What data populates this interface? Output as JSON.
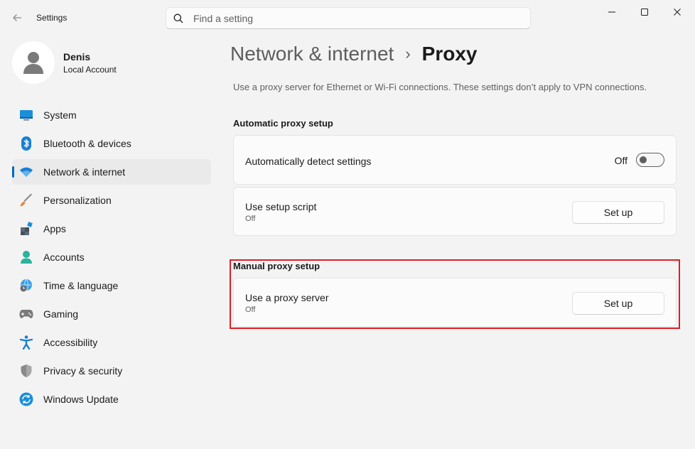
{
  "window": {
    "app_title": "Settings",
    "search_placeholder": "Find a setting"
  },
  "profile": {
    "name": "Denis",
    "account_type": "Local Account"
  },
  "sidebar": {
    "items": [
      {
        "label": "System",
        "icon": "system-icon"
      },
      {
        "label": "Bluetooth & devices",
        "icon": "bluetooth-icon"
      },
      {
        "label": "Network & internet",
        "icon": "wifi-icon",
        "active": true
      },
      {
        "label": "Personalization",
        "icon": "brush-icon"
      },
      {
        "label": "Apps",
        "icon": "apps-icon"
      },
      {
        "label": "Accounts",
        "icon": "accounts-icon"
      },
      {
        "label": "Time & language",
        "icon": "globe-clock-icon"
      },
      {
        "label": "Gaming",
        "icon": "gamepad-icon"
      },
      {
        "label": "Accessibility",
        "icon": "accessibility-icon"
      },
      {
        "label": "Privacy & security",
        "icon": "shield-icon"
      },
      {
        "label": "Windows Update",
        "icon": "update-icon"
      }
    ]
  },
  "main": {
    "breadcrumb_parent": "Network & internet",
    "breadcrumb_separator": "›",
    "page_title": "Proxy",
    "description": "Use a proxy server for Ethernet or Wi-Fi connections. These settings don’t apply to VPN connections.",
    "automatic": {
      "section_title": "Automatic proxy setup",
      "detect": {
        "title": "Automatically detect settings",
        "state_label": "Off"
      },
      "script": {
        "title": "Use setup script",
        "status": "Off",
        "button": "Set up"
      }
    },
    "manual": {
      "section_title": "Manual proxy setup",
      "proxy": {
        "title": "Use a proxy server",
        "status": "Off",
        "button": "Set up"
      }
    }
  },
  "colors": {
    "accent": "#0067c0",
    "highlight": "#e01e25"
  }
}
